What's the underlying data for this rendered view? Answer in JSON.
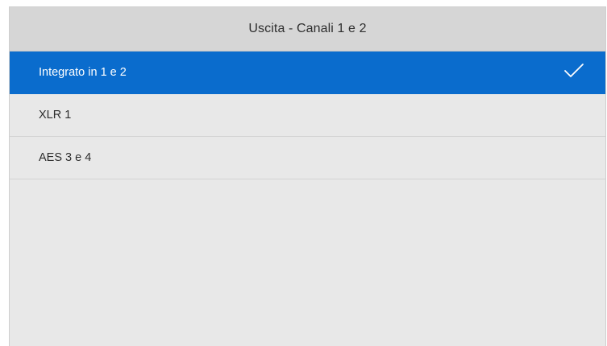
{
  "header": {
    "title": "Uscita - Canali 1 e 2"
  },
  "options": [
    {
      "label": "Integrato in 1 e 2",
      "selected": true
    },
    {
      "label": "XLR 1",
      "selected": false
    },
    {
      "label": "AES 3 e 4",
      "selected": false
    }
  ],
  "colors": {
    "selected_background": "#0a6ccd",
    "panel_background": "#e8e8e8",
    "header_background": "#d6d6d6"
  },
  "icons": {
    "selected_marker": "check-icon"
  }
}
